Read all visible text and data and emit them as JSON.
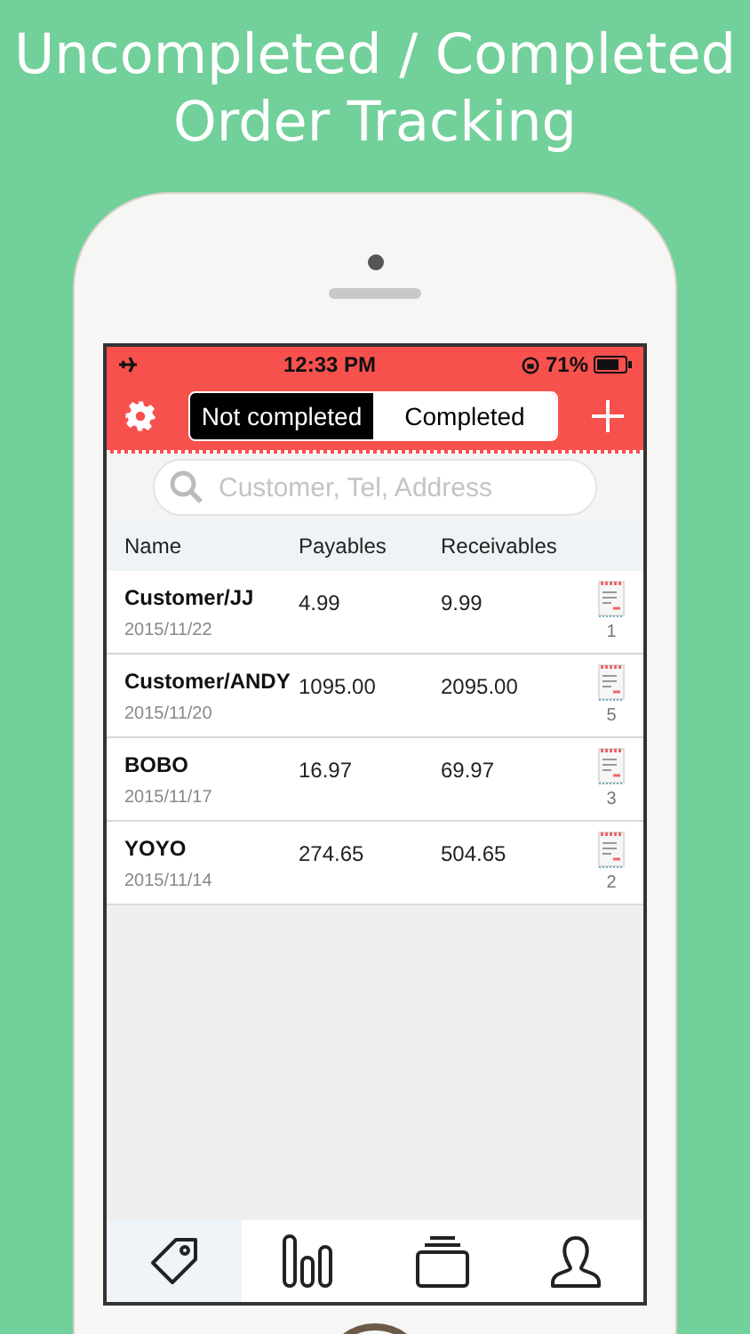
{
  "headline": [
    "Uncompleted / Completed",
    "Order Tracking"
  ],
  "status_bar": {
    "time": "12:33 PM",
    "battery": "71%"
  },
  "segments": [
    {
      "label": "Not completed",
      "selected": true
    },
    {
      "label": "Completed",
      "selected": false
    }
  ],
  "search": {
    "placeholder": "Customer, Tel, Address"
  },
  "table": {
    "columns": [
      "Name",
      "Payables",
      "Receivables"
    ],
    "rows": [
      {
        "name": "Customer/JJ",
        "date": "2015/11/22",
        "payables": "4.99",
        "receivables": "9.99",
        "count": "1"
      },
      {
        "name": "Customer/ANDY",
        "date": "2015/11/20",
        "payables": "1095.00",
        "receivables": "2095.00",
        "count": "5"
      },
      {
        "name": "BOBO",
        "date": "2015/11/17",
        "payables": "16.97",
        "receivables": "69.97",
        "count": "3"
      },
      {
        "name": "YOYO",
        "date": "2015/11/14",
        "payables": "274.65",
        "receivables": "504.65",
        "count": "2"
      }
    ]
  },
  "tab_bar": [
    {
      "kind": "tag",
      "selected": true
    },
    {
      "kind": "bars",
      "selected": false
    },
    {
      "kind": "stack",
      "selected": false
    },
    {
      "kind": "person",
      "selected": false
    }
  ]
}
